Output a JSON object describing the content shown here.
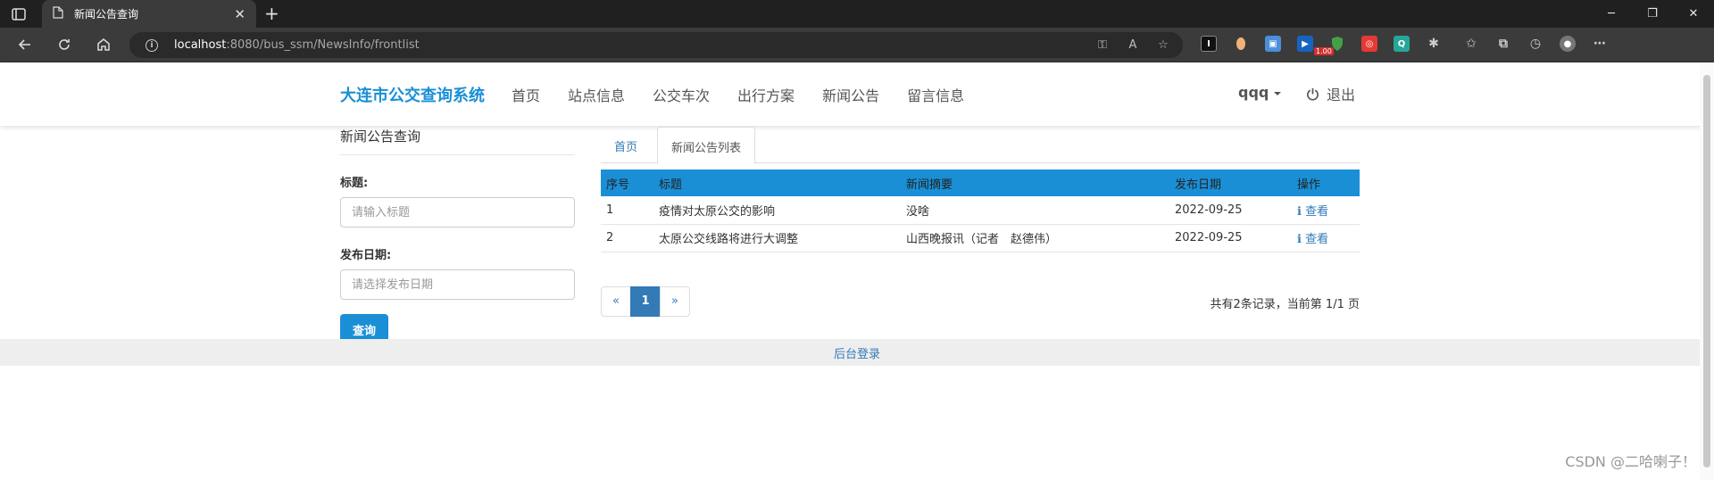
{
  "browser": {
    "tab_title": "新闻公告查询",
    "url_host": "localhost",
    "url_rest": ":8080/bus_ssm/NewsInfo/frontlist",
    "ext_badge": "1.00"
  },
  "navbar": {
    "brand": "大连市公交查询系统",
    "links": [
      "首页",
      "站点信息",
      "公交车次",
      "出行方案",
      "新闻公告",
      "留言信息"
    ],
    "user": "qqq",
    "logout": "退出"
  },
  "sidebar": {
    "title": "新闻公告查询",
    "title_label": "标题:",
    "title_placeholder": "请输入标题",
    "date_label": "发布日期:",
    "date_placeholder": "请选择发布日期",
    "query_button": "查询"
  },
  "main": {
    "tabs": [
      "首页",
      "新闻公告列表"
    ],
    "columns": [
      "序号",
      "标题",
      "新闻摘要",
      "发布日期",
      "操作"
    ],
    "rows": [
      {
        "no": "1",
        "title": "疫情对太原公交的影响",
        "summary": "没啥",
        "date": "2022-09-25",
        "action": "查看"
      },
      {
        "no": "2",
        "title": "太原公交线路将进行大调整",
        "summary": "山西晚报讯（记者　赵德伟）",
        "date": "2022-09-25",
        "action": "查看"
      }
    ],
    "pager": {
      "prev": "«",
      "current": "1",
      "next": "»"
    },
    "page_info": "共有2条记录，当前第 1/1 页"
  },
  "footer": {
    "admin_login": "后台登录"
  },
  "watermark": "CSDN @二哈喇子！"
}
